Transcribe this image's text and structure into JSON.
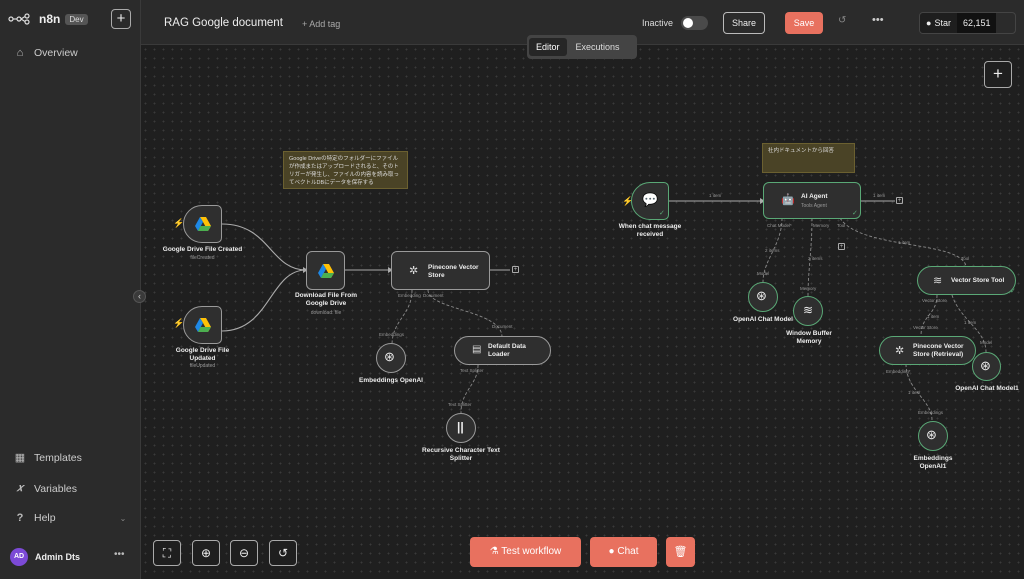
{
  "app": {
    "brand": "n8n",
    "env_badge": "Dev"
  },
  "sidebar": {
    "items": [
      {
        "label": "Overview",
        "icon": "home-icon"
      }
    ],
    "bottom_items": [
      {
        "label": "Templates",
        "icon": "templates-icon"
      },
      {
        "label": "Variables",
        "icon": "variables-icon"
      },
      {
        "label": "Help",
        "icon": "help-icon"
      }
    ],
    "user": {
      "initials": "AD",
      "name": "Admin Dts"
    }
  },
  "header": {
    "title": "RAG Google document",
    "add_tag": "+ Add tag",
    "active_label": "Inactive",
    "share_label": "Share",
    "save_label": "Save",
    "github": {
      "star_label": "Star",
      "count": "62,151"
    },
    "tabs": [
      {
        "label": "Editor",
        "active": true
      },
      {
        "label": "Executions",
        "active": false
      }
    ]
  },
  "canvas": {
    "stickies": [
      {
        "text": "Google Driveの特定のフォルダーにファイルが作成またはアップロードされると、そのトリガーが発生し、ファイルの内容を読み取ってベクトルDBにデータを保存する"
      },
      {
        "text": "社内ドキュメントから回答"
      }
    ],
    "nodes": {
      "gd_created": {
        "label": "Google Drive File Created",
        "sub": "fileCreated"
      },
      "gd_updated": {
        "label": "Google Drive File Updated",
        "sub": "fileUpdated"
      },
      "download": {
        "label": "Download File From Google Drive",
        "sub": "download: file"
      },
      "pinecone": {
        "label": "Pinecone Vector Store"
      },
      "embeddings": {
        "label": "Embeddings OpenAI"
      },
      "loader": {
        "label": "Default Data Loader"
      },
      "splitter": {
        "label": "Recursive Character Text Splitter"
      },
      "chat_trigger": {
        "label": "When chat message received"
      },
      "agent": {
        "label": "AI Agent",
        "sub": "Tools Agent"
      },
      "openai_chat": {
        "label": "OpenAI Chat Model"
      },
      "memory": {
        "label": "Window Buffer Memory"
      },
      "vs_tool": {
        "label": "Vector Store Tool"
      },
      "pinecone_retrieval": {
        "label": "Pinecone Vector Store (Retrieval)"
      },
      "openai_chat1": {
        "label": "OpenAI Chat Model1"
      },
      "embeddings1": {
        "label": "Embeddings OpenAI1"
      }
    },
    "port_labels": {
      "embedding": "Embedding",
      "document": "Document",
      "embeddings_in": "Embeddings",
      "document_in": "Document",
      "text_splitter": "Text Splitter",
      "text_splitter_in": "Text Splitter",
      "chat_model": "Chat Model*",
      "memory": "Memory",
      "tool": "Tool",
      "model": "Model",
      "memory_in": "Memory",
      "vector_store": "Vector Store",
      "model_in": "Model",
      "embedding_req": "Embedding*",
      "embeddings_in2": "Embeddings",
      "vector_store_in": "Vector Store",
      "tool_in": "Tool"
    },
    "edge_labels": {
      "one_item": "1 item",
      "two_items": "2 items"
    },
    "controls": {
      "test_workflow": "Test workflow",
      "chat": "Chat"
    }
  }
}
